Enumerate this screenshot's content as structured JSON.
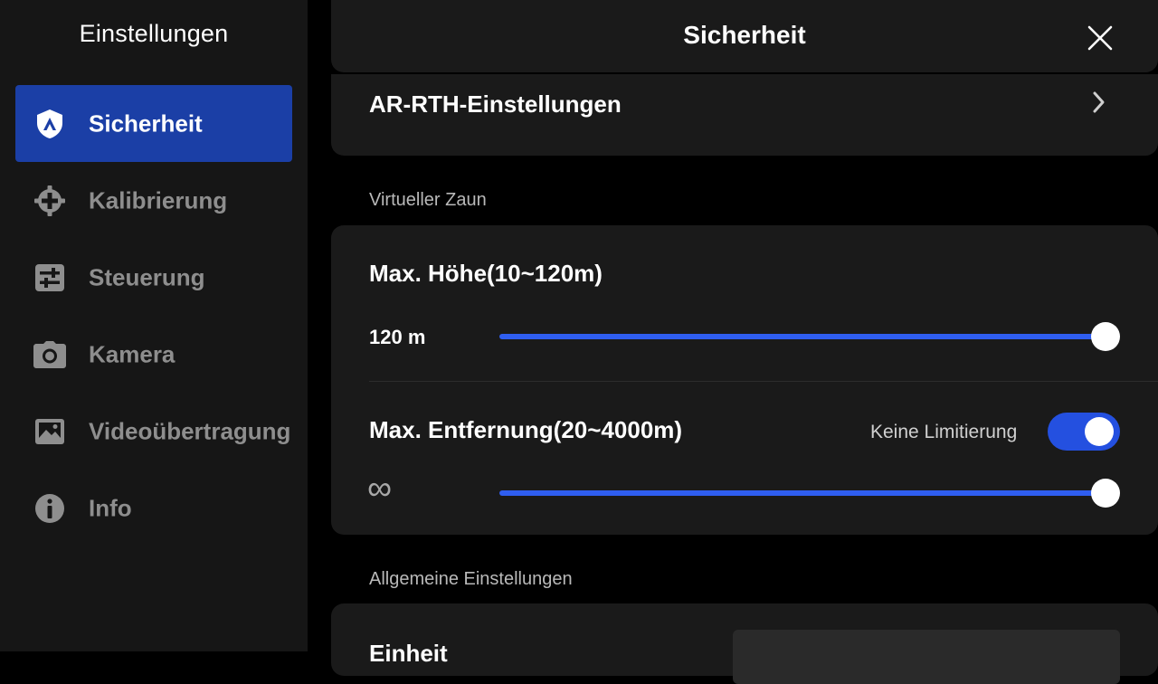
{
  "sidebar": {
    "title": "Einstellungen",
    "items": [
      {
        "label": "Sicherheit",
        "icon": "shield-icon",
        "active": true
      },
      {
        "label": "Kalibrierung",
        "icon": "crosshair-icon",
        "active": false
      },
      {
        "label": "Steuerung",
        "icon": "sliders-icon",
        "active": false
      },
      {
        "label": "Kamera",
        "icon": "camera-icon",
        "active": false
      },
      {
        "label": "Videoübertragung",
        "icon": "image-icon",
        "active": false
      },
      {
        "label": "Info",
        "icon": "info-icon",
        "active": false
      }
    ]
  },
  "header": {
    "title": "Sicherheit",
    "close_icon": "close-icon"
  },
  "rth": {
    "label": "AR-RTH-Einstellungen",
    "icon": "chevron-right-icon"
  },
  "fence": {
    "section_label": "Virtueller Zaun",
    "max_height": {
      "title": "Max. Höhe(10~120m)",
      "value_text": "120 m",
      "slider_fraction": 1.0
    },
    "max_distance": {
      "title": "Max. Entfernung(20~4000m)",
      "toggle_label": "Keine Limitierung",
      "toggle_on": true,
      "value_text": "∞",
      "slider_fraction": 1.0
    }
  },
  "general": {
    "section_label": "Allgemeine Einstellungen",
    "first_row_title": "Einheit"
  },
  "colors": {
    "accent": "#2f5ef0",
    "active_nav": "#1b3fa6",
    "sidebar_bg": "#161616",
    "card_bg": "#1a1a1a"
  }
}
